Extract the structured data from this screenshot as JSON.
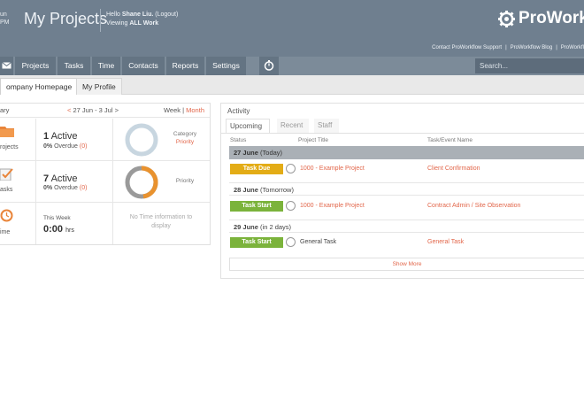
{
  "header": {
    "clock_line1": "un",
    "clock_line2": "PM",
    "title": "My Projects",
    "hello_prefix": "Hello",
    "user_name": "Shane Liu.",
    "logout": "(Logout)",
    "viewing_prefix": "Viewing",
    "viewing_scope": "ALL Work",
    "brand": "ProWorkfl",
    "links": [
      "Contact ProWorkflow Support",
      "ProWorkflow Blog",
      "ProWorkfl"
    ],
    "link_sep": "|"
  },
  "nav": {
    "items": [
      "Projects",
      "Tasks",
      "Time",
      "Contacts",
      "Reports",
      "Settings"
    ],
    "search_placeholder": "Search..."
  },
  "subtabs": [
    "ompany Homepage",
    "My Profile"
  ],
  "summary": {
    "title": "ary",
    "prev_arrow": "<",
    "range": "27 Jun - 3 Jul",
    "next_arrow": ">",
    "week": "Week",
    "sep": "|",
    "month": "Month",
    "projects": {
      "label": "rojects",
      "active_count": "1",
      "active_label": "Active",
      "overdue_pct": "0%",
      "overdue_label": "Overdue",
      "overdue_count": "(0)",
      "category": "Category",
      "category_value": "Priority"
    },
    "tasks": {
      "label": "asks",
      "active_count": "7",
      "active_label": "Active",
      "overdue_pct": "0%",
      "overdue_label": "Overdue",
      "overdue_count": "(0)",
      "category": "Priority"
    },
    "time": {
      "label": "ime",
      "week_label": "This Week",
      "hours": "0:00",
      "hours_unit": "hrs",
      "no_time": "No Time information to display"
    }
  },
  "activity": {
    "title": "Activity",
    "tabs": [
      "Upcoming",
      "Recent",
      "Staff"
    ],
    "columns": {
      "status": "Status",
      "project": "Project Title",
      "task": "Task/Event Name"
    },
    "groups": [
      {
        "date": "27 June",
        "note": "(Today)",
        "status": "Task Due",
        "project": "1000 - Example Project",
        "task": "Client Confirmation"
      },
      {
        "date": "28 June",
        "note": "(Tomorrow)",
        "status": "Task Start",
        "project": "1000 - Example Project",
        "task": "Contract Admin / Site Observation"
      },
      {
        "date": "29 June",
        "note": "(in 2 days)",
        "status": "Task Start",
        "project": "General Task",
        "task": "General Task"
      }
    ],
    "show_more": "Show More"
  },
  "colors": {
    "header": "#6f7f8f",
    "accent": "#e2664a",
    "due": "#e3ac16",
    "start": "#7bb33b"
  }
}
